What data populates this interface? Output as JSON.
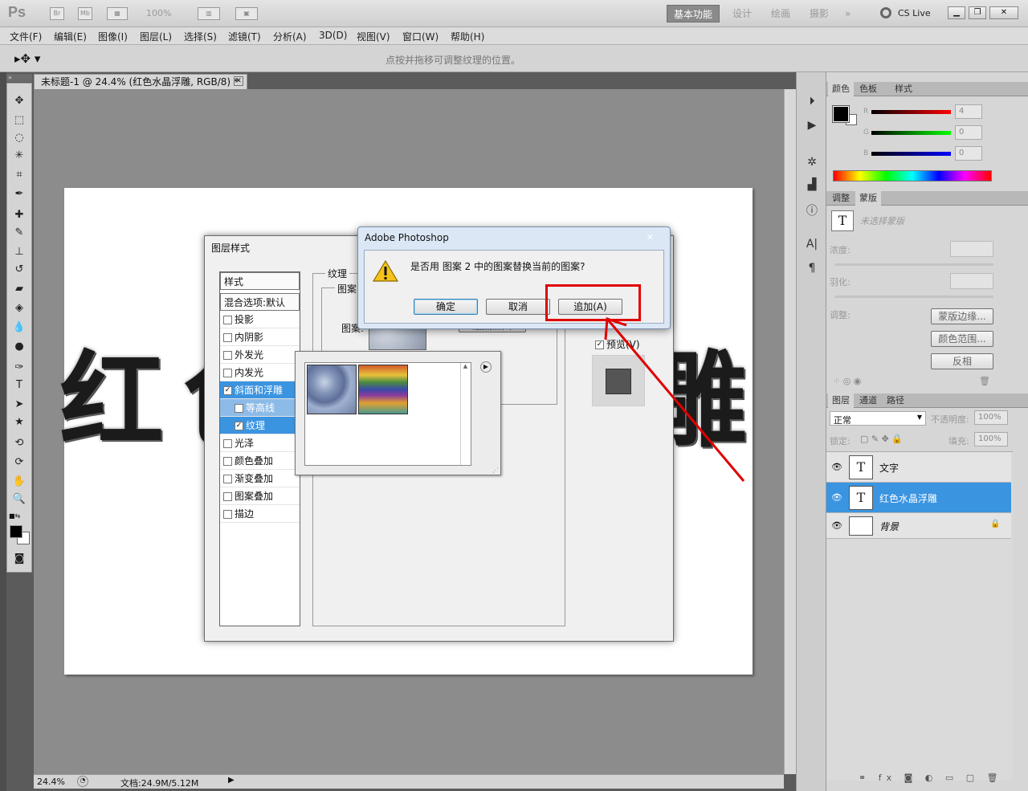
{
  "titlebar": {
    "logo": "Ps",
    "bridge": "Br",
    "minibridge": "Mb",
    "zoom": "100%",
    "workspaces": [
      "基本功能",
      "设计",
      "绘画",
      "摄影"
    ],
    "more": "»",
    "cslive": "CS Live"
  },
  "menu": [
    "文件(F)",
    "编辑(E)",
    "图像(I)",
    "图层(L)",
    "选择(S)",
    "滤镜(T)",
    "分析(A)",
    "3D(D)",
    "视图(V)",
    "窗口(W)",
    "帮助(H)"
  ],
  "options": {
    "hint": "点按并拖移可调整纹理的位置。"
  },
  "document": {
    "tab_title": "未标题-1 @ 24.4% (红色水晶浮雕, RGB/8) *",
    "close": "✕",
    "canvas_chars": [
      "红",
      "色",
      "雕"
    ],
    "zoom": "24.4%",
    "doc_size": "文档:24.9M/5.12M"
  },
  "layer_style": {
    "title": "图层样式",
    "styles_header": "样式",
    "blend_options": "混合选项:默认",
    "items": [
      {
        "label": "投影",
        "checked": false
      },
      {
        "label": "内阴影",
        "checked": false
      },
      {
        "label": "外发光",
        "checked": false
      },
      {
        "label": "内发光",
        "checked": false
      },
      {
        "label": "斜面和浮雕",
        "checked": true
      },
      {
        "label": "等高线",
        "checked": false
      },
      {
        "label": "纹理",
        "checked": true
      },
      {
        "label": "光泽",
        "checked": false
      },
      {
        "label": "颜色叠加",
        "checked": false
      },
      {
        "label": "渐变叠加",
        "checked": false
      },
      {
        "label": "图案叠加",
        "checked": false
      },
      {
        "label": "描边",
        "checked": false
      }
    ],
    "texture_group": "纹理",
    "pattern_group": "图案",
    "pattern_label": "图案:",
    "snap_button": "贴紧原点(A)",
    "preview_label": "预览(V)"
  },
  "alert": {
    "title": "Adobe Photoshop",
    "message": "是否用 图案 2 中的图案替换当前的图案?",
    "ok": "确定",
    "cancel": "取消",
    "append": "追加(A)"
  },
  "color_panel": {
    "tabs": [
      "颜色",
      "色板",
      "样式"
    ],
    "r_label": "R",
    "g_label": "G",
    "b_label": "B",
    "r": "4",
    "g": "0",
    "b": "0"
  },
  "adjust_panel": {
    "tabs": [
      "调整",
      "蒙版"
    ],
    "mask_state": "未选择蒙版",
    "density": "浓度:",
    "feather": "羽化:",
    "refine": "调整:",
    "mask_edge": "蒙版边缘...",
    "color_range": "颜色范围...",
    "invert": "反相"
  },
  "layers_panel": {
    "tabs": [
      "图层",
      "通道",
      "路径"
    ],
    "blend_mode": "正常",
    "opacity_label": "不透明度:",
    "opacity": "100%",
    "lock_label": "锁定:",
    "fill_label": "填充:",
    "fill": "100%",
    "layers": [
      {
        "name": "文字",
        "type": "T",
        "selected": false
      },
      {
        "name": "红色水晶浮雕",
        "type": "T",
        "selected": true
      },
      {
        "name": "背景",
        "type": "",
        "selected": false
      }
    ]
  }
}
